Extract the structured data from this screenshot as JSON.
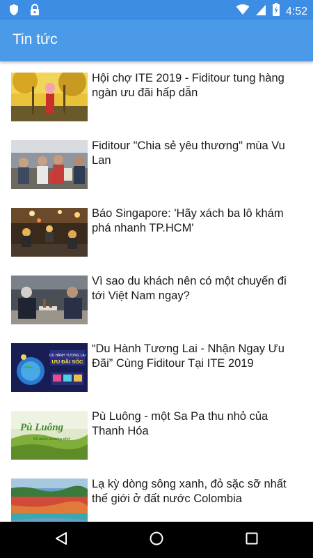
{
  "status_bar": {
    "time": "4:52",
    "left_icons": [
      "shield-icon",
      "lock-icon"
    ],
    "right_icons": [
      "wifi-icon",
      "signal-icon",
      "battery-charging-icon"
    ]
  },
  "app_bar": {
    "title": "Tin tức"
  },
  "articles": [
    {
      "title": "Hội chợ ITE 2019 - Fiditour tung hàng ngàn ưu đãi hấp dẫn"
    },
    {
      "title": "Fiditour \"Chia sẻ yêu thương\" mùa Vu Lan"
    },
    {
      "title": "Báo Singapore: 'Hãy xách ba lô khám phá nhanh TP.HCM'"
    },
    {
      "title": "Vì sao du khách nên có một chuyến đi tới Việt Nam ngay?"
    },
    {
      "title": "“Du Hành Tương Lai - Nhận Ngay Ưu Đãi” Cùng Fiditour Tại ITE 2019"
    },
    {
      "title": "Pù Luông - một Sa Pa thu nhỏ của Thanh Hóa"
    },
    {
      "title": "Lạ kỳ dòng sông xanh, đỏ sặc sỡ nhất thế giới ở đất nước Colombia"
    }
  ],
  "thumbnail_overlays": {
    "ite_banner_line1": "DU HÀNH TƯƠNG LAI",
    "ite_banner_line2": "ƯU ĐÃI SỐC",
    "puluong_title": "Pù Luông",
    "puluong_subtitle": "Về miền thương nhớ"
  },
  "nav_bar": {
    "buttons": [
      "back-icon",
      "home-icon",
      "recents-icon"
    ]
  },
  "colors": {
    "status_bar": "#3c8de3",
    "app_bar": "#4a9ae8",
    "nav_bar": "#000000"
  }
}
